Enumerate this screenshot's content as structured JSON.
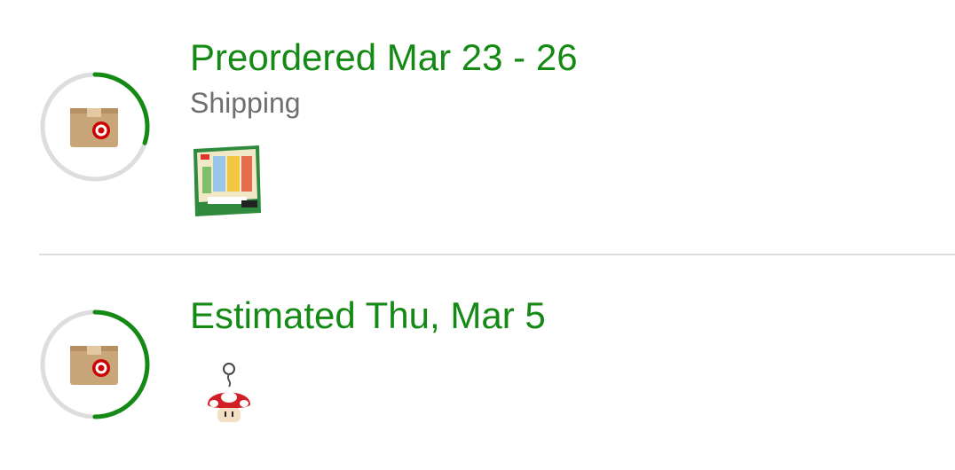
{
  "orders": [
    {
      "status_title": "Preordered Mar 23 - 26",
      "status_subtitle": "Shipping",
      "progress": 0.3,
      "ring_icon": "target-package-icon",
      "product_icon": "trading-card-box-image"
    },
    {
      "status_title": "Estimated Thu, Mar 5",
      "progress": 0.5,
      "ring_icon": "target-package-icon",
      "product_icon": "mushroom-keychain-image"
    }
  ],
  "colors": {
    "accent_green": "#148a14",
    "ring_track": "#dddddd",
    "subtitle_gray": "#6f6f6f",
    "box_tan": "#c9a57a",
    "target_red": "#cc0000"
  }
}
